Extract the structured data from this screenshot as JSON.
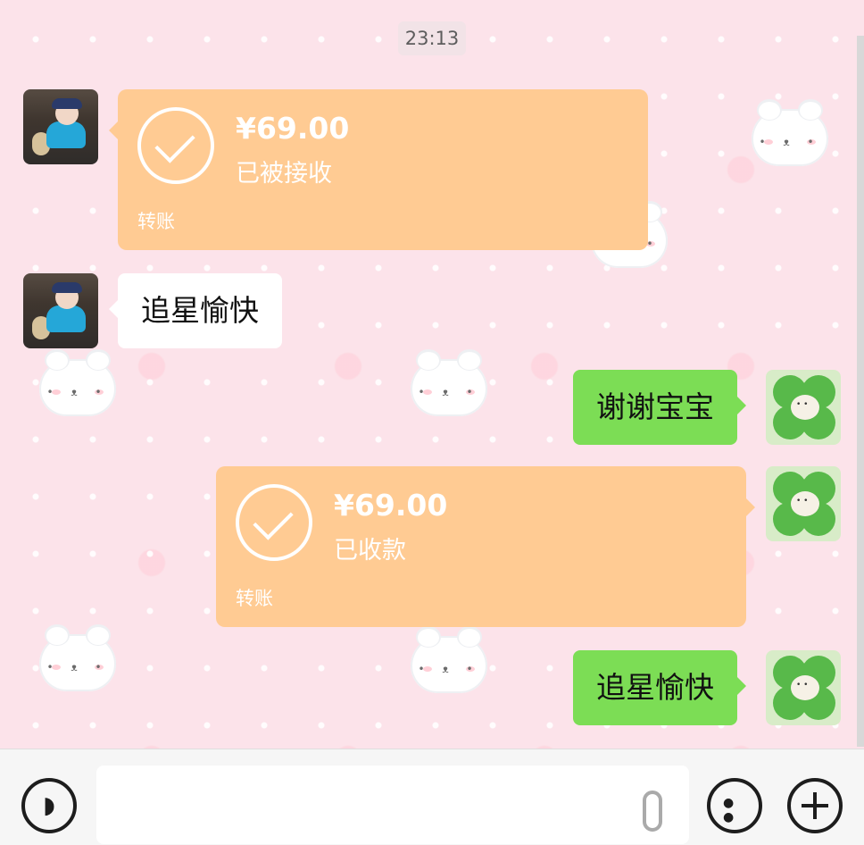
{
  "chat": {
    "timestamp": "23:13",
    "messages": [
      {
        "side": "left",
        "type": "transfer",
        "amount": "¥69.00",
        "status": "已被接收",
        "kind": "转账"
      },
      {
        "side": "left",
        "type": "text",
        "text": "追星愉快"
      },
      {
        "side": "right",
        "type": "text",
        "text": "谢谢宝宝"
      },
      {
        "side": "right",
        "type": "transfer",
        "amount": "¥69.00",
        "status": "已收款",
        "kind": "转账"
      },
      {
        "side": "right",
        "type": "text",
        "text": "追星愉快"
      }
    ]
  },
  "input_bar": {
    "voice_icon": "voice-icon",
    "emoji_icon": "emoji-icon",
    "plus_icon": "plus-icon",
    "input_value": ""
  },
  "colors": {
    "bubble_green": "#7cdd55",
    "transfer_orange": "#ffcb93",
    "background_pink": "#fce3ea"
  }
}
